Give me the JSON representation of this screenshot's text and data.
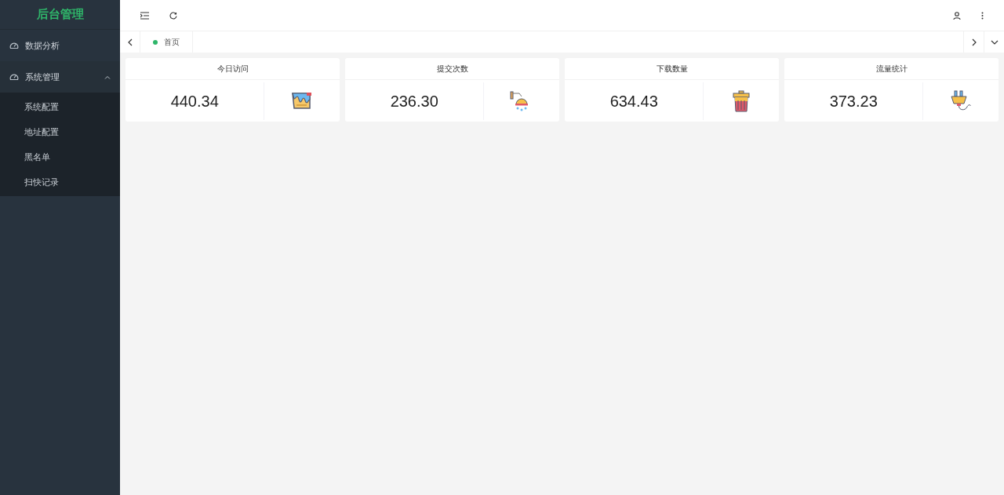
{
  "sidebar": {
    "logo": "后台管理",
    "items": [
      {
        "label": "数据分析"
      },
      {
        "label": "系统管理",
        "expanded": true,
        "children": [
          {
            "label": "系统配置"
          },
          {
            "label": "地址配置"
          },
          {
            "label": "黑名单"
          },
          {
            "label": "扫快记录"
          }
        ]
      }
    ]
  },
  "tabs": [
    {
      "label": "首页",
      "selected": true
    }
  ],
  "cards": [
    {
      "title": "今日访问",
      "value": "440.34",
      "kind": "bucket"
    },
    {
      "title": "提交次数",
      "value": "236.30",
      "kind": "shower"
    },
    {
      "title": "下载数量",
      "value": "634.43",
      "kind": "trash"
    },
    {
      "title": "流量统计",
      "value": "373.23",
      "kind": "plug"
    }
  ]
}
